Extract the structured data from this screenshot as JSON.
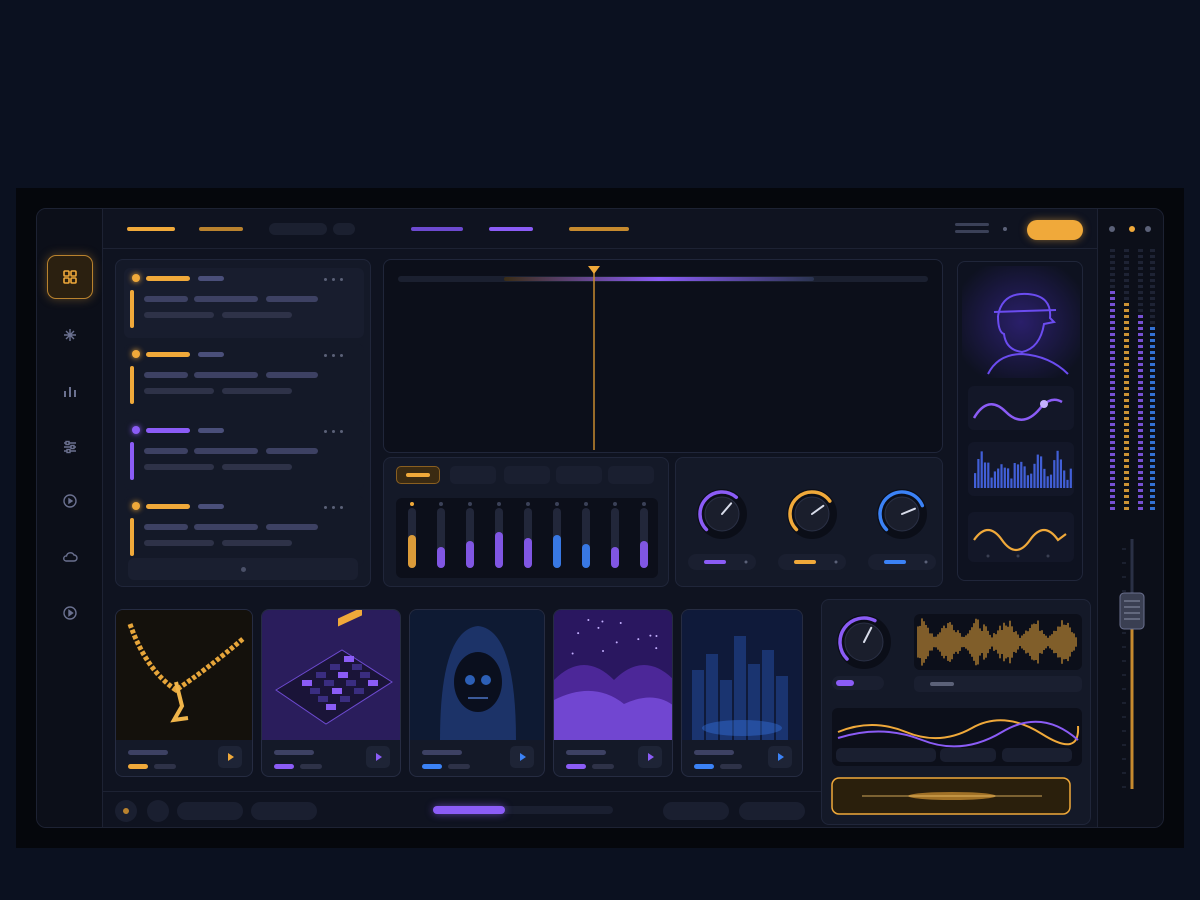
{
  "app": {
    "accent_gold": "#f0a93a",
    "accent_purple": "#8b5cf6",
    "accent_blue": "#3b82f6",
    "background": "#0f1320"
  },
  "nav": {
    "items": [
      {
        "icon": "grid-icon",
        "active": true
      },
      {
        "icon": "sparkle-icon",
        "active": false
      },
      {
        "icon": "bar-chart-icon",
        "active": false
      },
      {
        "icon": "sliders-icon",
        "active": false
      },
      {
        "icon": "disc-icon",
        "active": false
      },
      {
        "icon": "cloud-icon",
        "active": false
      },
      {
        "icon": "play-circle-icon",
        "active": false
      }
    ]
  },
  "tracks": [
    {
      "color": "#f0a93a",
      "state": "active"
    },
    {
      "color": "#f0a93a",
      "state": "idle"
    },
    {
      "color": "#8b5cf6",
      "state": "idle"
    },
    {
      "color": "#f0a93a",
      "state": "idle"
    }
  ],
  "knobs": [
    {
      "color": "#8b5cf6",
      "level": 0.65
    },
    {
      "color": "#f0a93a",
      "level": 0.7
    },
    {
      "color": "#3b82f6",
      "level": 0.75
    },
    {
      "color": "#8b5cf6",
      "level": 0.6
    }
  ],
  "faders": [
    {
      "color": "#f0a93a",
      "level": 0.55
    },
    {
      "color": "#8b5cf6",
      "level": 0.35
    },
    {
      "color": "#8b5cf6",
      "level": 0.45
    },
    {
      "color": "#8b5cf6",
      "level": 0.6
    },
    {
      "color": "#8b5cf6",
      "level": 0.5
    },
    {
      "color": "#3b82f6",
      "level": 0.55
    },
    {
      "color": "#3b82f6",
      "level": 0.4
    },
    {
      "color": "#8b5cf6",
      "level": 0.35
    },
    {
      "color": "#8b5cf6",
      "level": 0.45
    }
  ],
  "cards": [
    {
      "art": "gold-chain",
      "accent": "#f0a93a"
    },
    {
      "art": "drum-pad",
      "accent": "#8b5cf6"
    },
    {
      "art": "hooded-skull",
      "accent": "#3b82f6"
    },
    {
      "art": "purple-clouds",
      "accent": "#8b5cf6"
    },
    {
      "art": "night-city",
      "accent": "#3b82f6"
    }
  ],
  "transport": {
    "progress": 0.4
  },
  "master_fader": {
    "level": 0.72
  }
}
